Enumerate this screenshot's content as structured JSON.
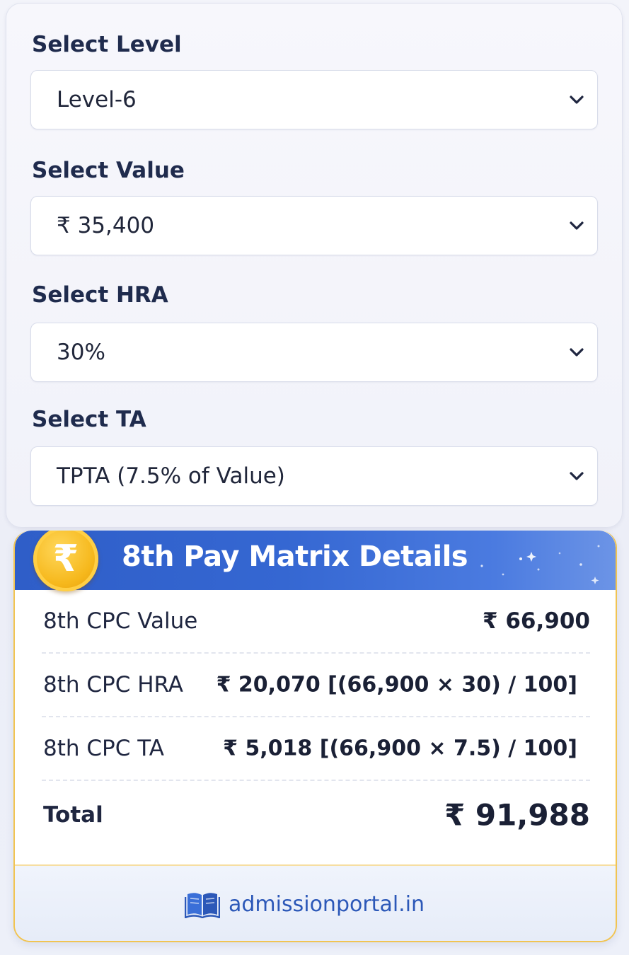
{
  "form": {
    "level": {
      "label": "Select Level",
      "selected": "Level-6"
    },
    "value": {
      "label": "Select Value",
      "selected": "₹ 35,400"
    },
    "hra": {
      "label": "Select HRA",
      "selected": "30%"
    },
    "ta": {
      "label": "Select TA",
      "selected": "TPTA (7.5% of Value)"
    }
  },
  "result": {
    "title": "8th Pay Matrix Details",
    "coin_symbol": "₹",
    "rows": [
      {
        "label": "8th CPC Value",
        "value": "₹ 66,900"
      },
      {
        "label": "8th CPC HRA",
        "value": "₹ 20,070 [(66,900 × 30) / 100]"
      },
      {
        "label": "8th CPC TA",
        "value": "₹ 5,018 [(66,900 × 7.5) / 100]"
      }
    ],
    "total": {
      "label": "Total",
      "value": "₹ 91,988"
    }
  },
  "footer": {
    "site": "admissionportal.in",
    "icon": "book-icon"
  },
  "colors": {
    "header_blue": "#3567d2",
    "coin_gold": "#f6b81c",
    "border_gold": "#f1c452",
    "label_navy": "#1f2b4d",
    "footer_blue": "#2c58b8"
  }
}
